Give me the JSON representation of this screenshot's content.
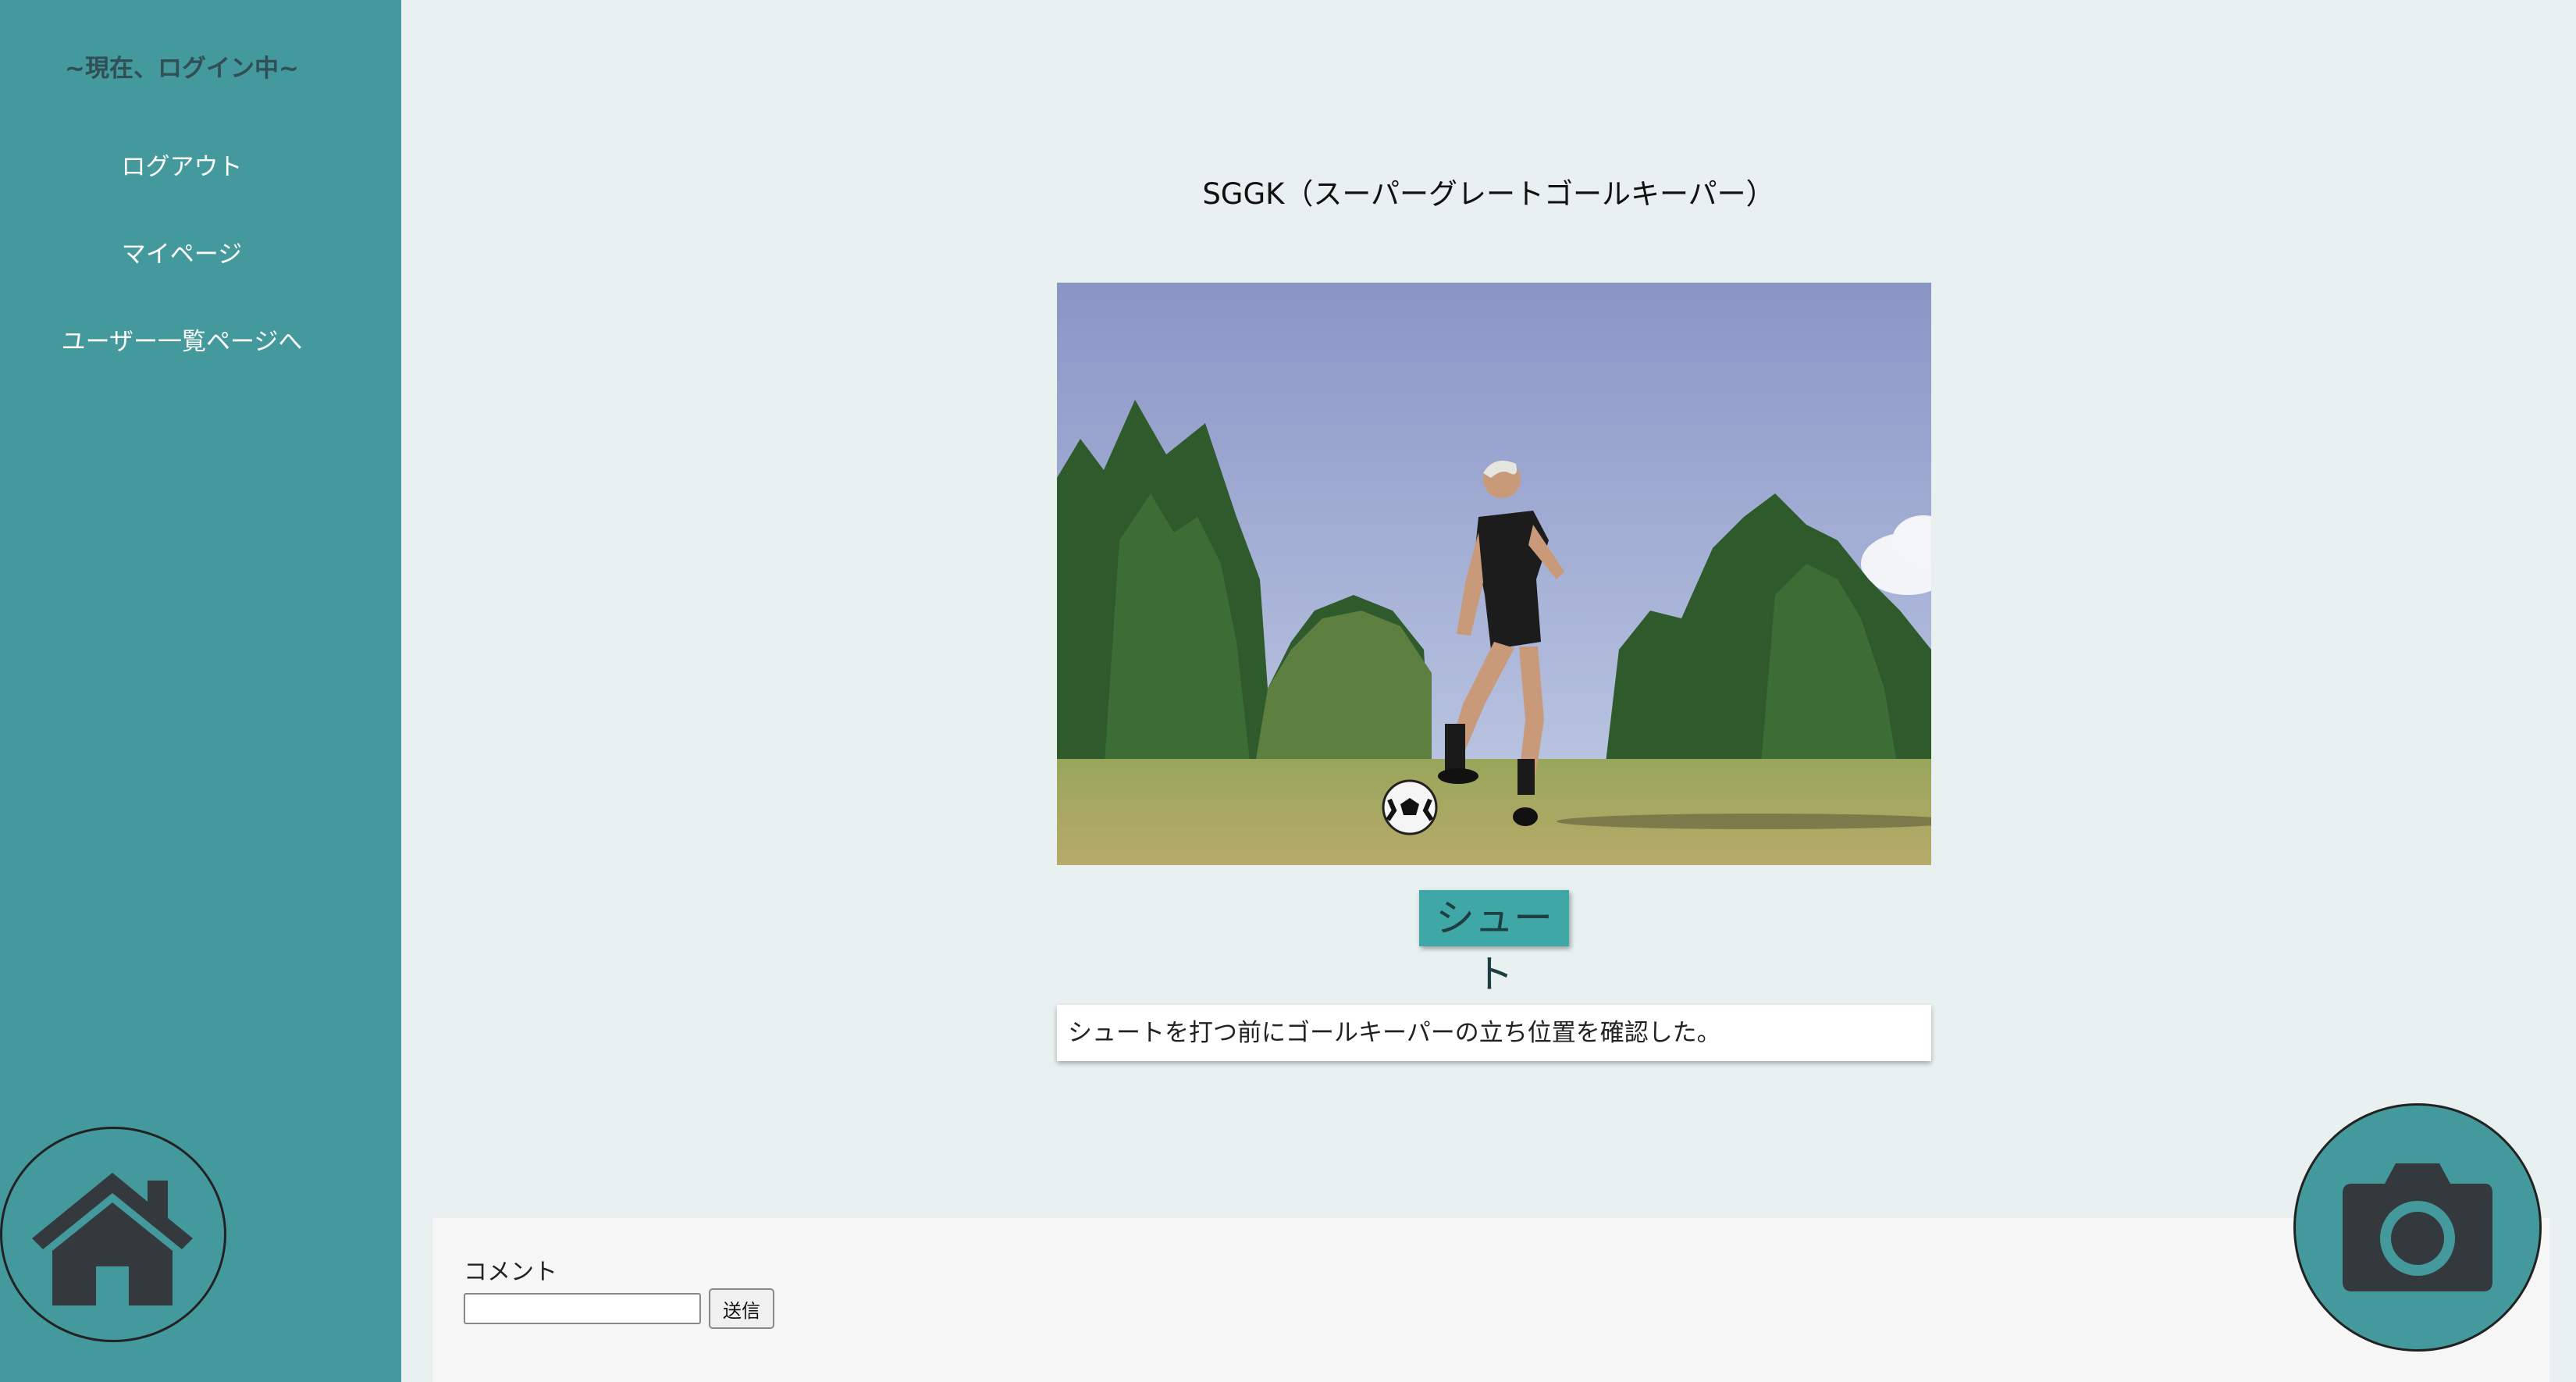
{
  "sidebar": {
    "status": "~現在、ログイン中~",
    "items": [
      {
        "label": "ログアウト"
      },
      {
        "label": "マイページ"
      },
      {
        "label": "ユーザー一覧ページへ"
      }
    ]
  },
  "post": {
    "title": "SGGK（スーパーグレートゴールキーパー）",
    "category": "シュート",
    "description": "シュートを打つ前にゴールキーパーの立ち位置を確認した。"
  },
  "comment": {
    "label": "コメント",
    "value": "",
    "submit_label": "送信"
  },
  "icons": {
    "home": "home-icon",
    "camera": "camera-icon"
  },
  "colors": {
    "sidebar": "#44999d",
    "background": "#e8f0f0",
    "accent": "#3fa7a6",
    "icon": "#33393d"
  }
}
